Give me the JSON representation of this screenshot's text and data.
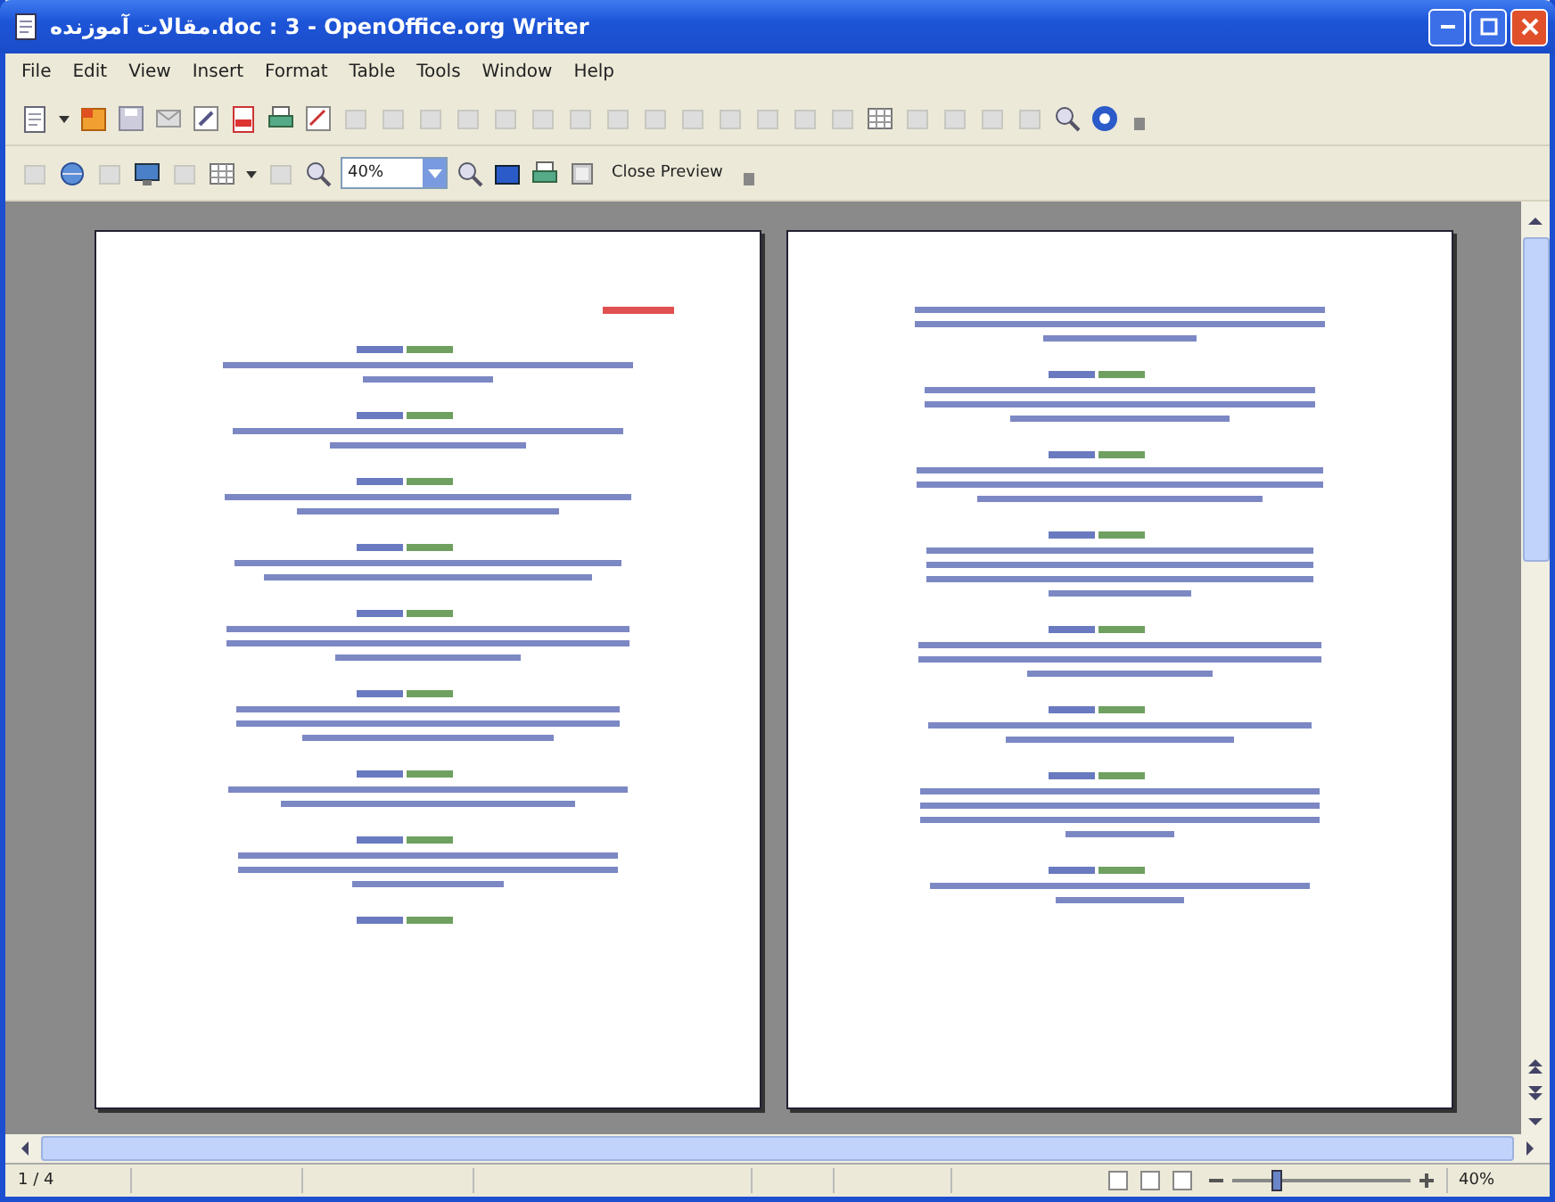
{
  "window": {
    "title": "مقالات آموزنده.doc : 3 - OpenOffice.org Writer"
  },
  "menu": [
    "File",
    "Edit",
    "View",
    "Insert",
    "Format",
    "Table",
    "Tools",
    "Window",
    "Help"
  ],
  "preview_toolbar": {
    "zoom_value": "40%",
    "close_button": "Close Preview"
  },
  "status_bar": {
    "page": "1 / 4",
    "zoom_slider": {
      "level": 0.25
    },
    "zoom": "40%"
  }
}
